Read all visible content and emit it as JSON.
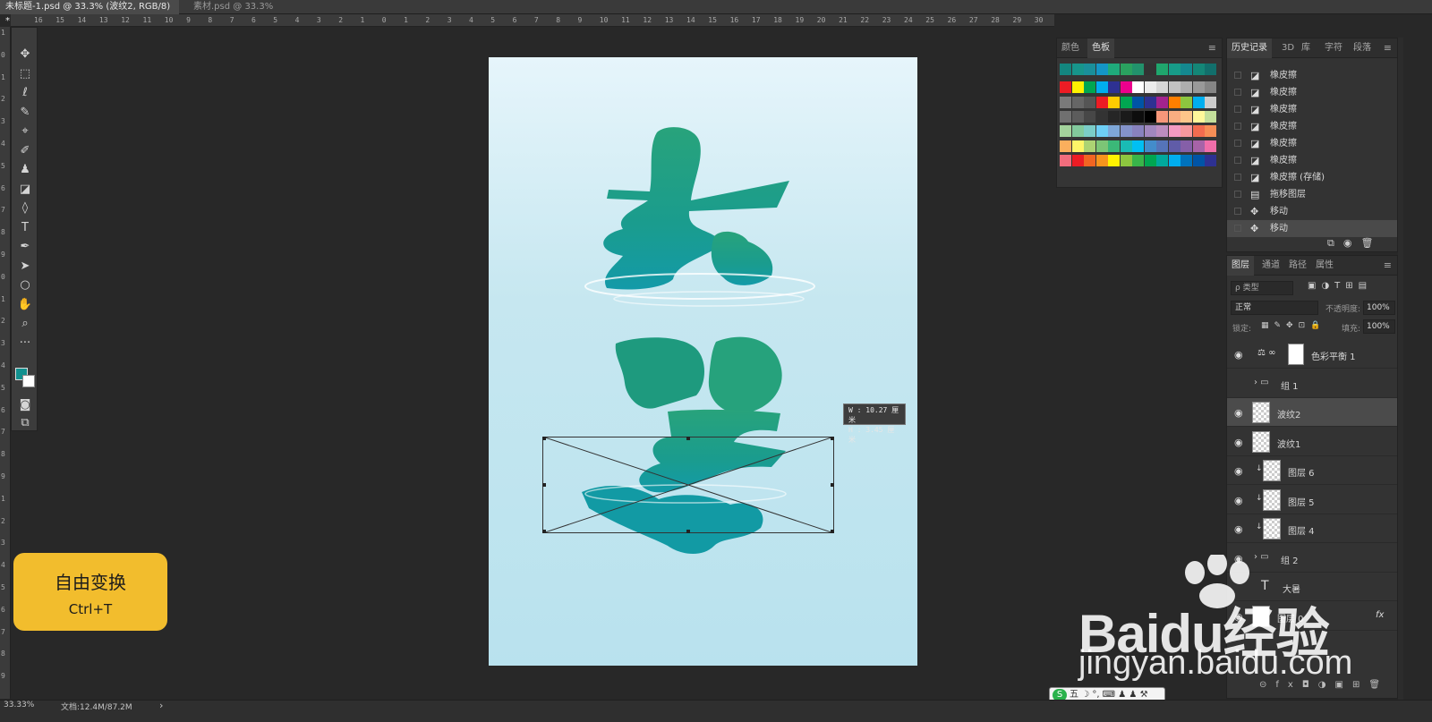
{
  "tabs": [
    {
      "label": "未标题-1.psd @ 33.3% (波纹2, RGB/8) *",
      "active": true
    },
    {
      "label": "素材.psd @ 33.3%(RGB/8)",
      "active": false
    }
  ],
  "tab_close_icon": "×",
  "rulers": {
    "top": [
      "16",
      "15",
      "14",
      "13",
      "12",
      "11",
      "10",
      "9",
      "8",
      "7",
      "6",
      "5",
      "4",
      "3",
      "2",
      "1",
      "0",
      "1",
      "2",
      "3",
      "4",
      "5",
      "6",
      "7",
      "8",
      "9",
      "10",
      "11",
      "12",
      "13",
      "14",
      "15",
      "16",
      "17",
      "18",
      "19",
      "20",
      "21",
      "22",
      "23",
      "24",
      "25",
      "26",
      "27",
      "28",
      "29",
      "30",
      "31",
      "32"
    ],
    "left": [
      "1",
      "0",
      "1",
      "2",
      "3",
      "4",
      "5",
      "6",
      "7",
      "8",
      "9",
      "0",
      "1",
      "2",
      "3",
      "4",
      "5",
      "6",
      "7",
      "8",
      "9",
      "1",
      "2",
      "3",
      "4",
      "5",
      "6",
      "7",
      "8",
      "9"
    ]
  },
  "toolbar": {
    "tools": [
      {
        "name": "move-tool",
        "glyph": "✥"
      },
      {
        "name": "marquee-tool",
        "glyph": "⬚"
      },
      {
        "name": "lasso-tool",
        "glyph": "ℓ"
      },
      {
        "name": "magic-wand-tool",
        "glyph": "✎"
      },
      {
        "name": "eyedropper-tool",
        "glyph": "⌖"
      },
      {
        "name": "brush-tool",
        "glyph": "✐"
      },
      {
        "name": "stamp-tool",
        "glyph": "♟"
      },
      {
        "name": "eraser-tool",
        "glyph": "◪"
      },
      {
        "name": "bucket-tool",
        "glyph": "◊"
      },
      {
        "name": "type-tool",
        "glyph": "T"
      },
      {
        "name": "pen-tool",
        "glyph": "✒"
      },
      {
        "name": "path-select-tool",
        "glyph": "➤"
      },
      {
        "name": "ellipse-tool",
        "glyph": "○"
      },
      {
        "name": "hand-tool",
        "glyph": "✋"
      },
      {
        "name": "zoom-tool",
        "glyph": "⌕"
      },
      {
        "name": "more-tools",
        "glyph": "···"
      }
    ],
    "fg_color": "#12918f",
    "bg_color": "#ffffff"
  },
  "transform_readout": {
    "w": "W :  10.27 厘米",
    "h": "H :   3.45 厘米"
  },
  "shortcut": {
    "title": "自由变换",
    "keys": "Ctrl+T",
    "color": "#f2bd2d"
  },
  "swatch_panel": {
    "tabs": [
      "颜色",
      "色板"
    ],
    "active_tab": "色板",
    "menu_icon": "≡",
    "rows": [
      [
        "#13867f",
        "#17958b",
        "#1a8f9a",
        "#1496c6",
        "#1faa7b",
        "#2aa15f",
        "#22926c",
        "#333333",
        "#1fa66d",
        "#179c89",
        "#14888f",
        "#148677",
        "#126f6c"
      ],
      [
        "#ed1c24",
        "#fff200",
        "#00a651",
        "#00aeef",
        "#2e3192",
        "#ec008c",
        "#ffffff",
        "#ebebeb",
        "#d6d6d6",
        "#c2c2c2",
        "#adadad",
        "#999999",
        "#858585"
      ],
      [
        "#7a7a7a",
        "#666666",
        "#555555",
        "#ed1c24",
        "#ffcc00",
        "#00a651",
        "#0054a6",
        "#2e3192",
        "#a3238e",
        "#ff7f00",
        "#8dc63f",
        "#00aeef",
        "#cccccc"
      ],
      [
        "#707070",
        "#5c5c5c",
        "#474747",
        "#333333",
        "#262626",
        "#1a1a1a",
        "#0d0d0d",
        "#000000",
        "#f7977a",
        "#f9ad81",
        "#fdc68a",
        "#fff79a",
        "#c4df9b"
      ],
      [
        "#a3d39c",
        "#82ca9d",
        "#7bcdc8",
        "#6ecff6",
        "#7ea7d8",
        "#8493ca",
        "#8882be",
        "#a187be",
        "#bc8dbf",
        "#f49ac2",
        "#f6989d",
        "#f26c4f",
        "#f68e56"
      ],
      [
        "#fbaf5d",
        "#fff568",
        "#acd373",
        "#7cc576",
        "#3bb878",
        "#1abbb4",
        "#00bff3",
        "#438ccb",
        "#5574b9",
        "#605ca8",
        "#855fa8",
        "#a763a8",
        "#f06eaa"
      ],
      [
        "#f26d7d",
        "#ed1c24",
        "#f26522",
        "#f7941d",
        "#fff200",
        "#8dc63f",
        "#39b54a",
        "#00a651",
        "#00a99d",
        "#00aeef",
        "#0072bc",
        "#0054a6",
        "#2e3192"
      ]
    ]
  },
  "history_panel": {
    "tabs": [
      "历史记录",
      "3D",
      "库",
      "字符",
      "段落"
    ],
    "active_tab": "历史记录",
    "items": [
      {
        "label": "橡皮擦",
        "icon": "◪",
        "selected": false
      },
      {
        "label": "橡皮擦",
        "icon": "◪",
        "selected": false
      },
      {
        "label": "橡皮擦",
        "icon": "◪",
        "selected": false
      },
      {
        "label": "橡皮擦",
        "icon": "◪",
        "selected": false
      },
      {
        "label": "橡皮擦",
        "icon": "◪",
        "selected": false
      },
      {
        "label": "橡皮擦",
        "icon": "◪",
        "selected": false
      },
      {
        "label": "橡皮擦 (存储)",
        "icon": "◪",
        "selected": false
      },
      {
        "label": "拖移图层",
        "icon": "▤",
        "selected": false
      },
      {
        "label": "移动",
        "icon": "✥",
        "selected": false
      },
      {
        "label": "移动",
        "icon": "✥",
        "selected": true
      }
    ],
    "footer_icons": [
      "⧉",
      "◉",
      "🗑"
    ]
  },
  "layers_panel": {
    "tabs": [
      "图层",
      "通道",
      "路径",
      "属性"
    ],
    "active_tab": "图层",
    "filter_label": "ρ 类型",
    "blend_mode": "正常",
    "opacity_label": "不透明度:",
    "opacity_value": "100%",
    "lock_label": "锁定:",
    "fill_label": "填充:",
    "fill_value": "100%",
    "layers": [
      {
        "name": "色彩平衡 1",
        "visible": true,
        "kind": "adjustment",
        "selected": false
      },
      {
        "name": "组 1",
        "visible": false,
        "kind": "group",
        "selected": false
      },
      {
        "name": "波纹2",
        "visible": true,
        "kind": "pixel",
        "selected": true
      },
      {
        "name": "波纹1",
        "visible": true,
        "kind": "pixel",
        "selected": false
      },
      {
        "name": "图层 6",
        "visible": true,
        "kind": "clipped",
        "selected": false
      },
      {
        "name": "图层 5",
        "visible": true,
        "kind": "clipped",
        "selected": false
      },
      {
        "name": "图层 4",
        "visible": true,
        "kind": "clipped",
        "selected": false
      },
      {
        "name": "组 2",
        "visible": true,
        "kind": "group",
        "selected": false
      },
      {
        "name": "大暑",
        "visible": false,
        "kind": "text",
        "selected": false
      },
      {
        "name": "图层 0",
        "visible": true,
        "kind": "fill",
        "selected": false,
        "fx": "fx"
      }
    ],
    "footer_icons": [
      "⊝",
      "fx",
      "◘",
      "◑",
      "▣",
      "⊞",
      "🗑"
    ]
  },
  "statusbar": {
    "zoom": "33.33%",
    "doc": "文档:12.4M/87.2M",
    "arrow": "›"
  },
  "ime_bar": {
    "text": "五 ☽ °, ⌨ ♟ ♟ ⚒"
  },
  "watermark": {
    "logo": "Baidu经验",
    "url": "jingyan.baidu.com"
  }
}
